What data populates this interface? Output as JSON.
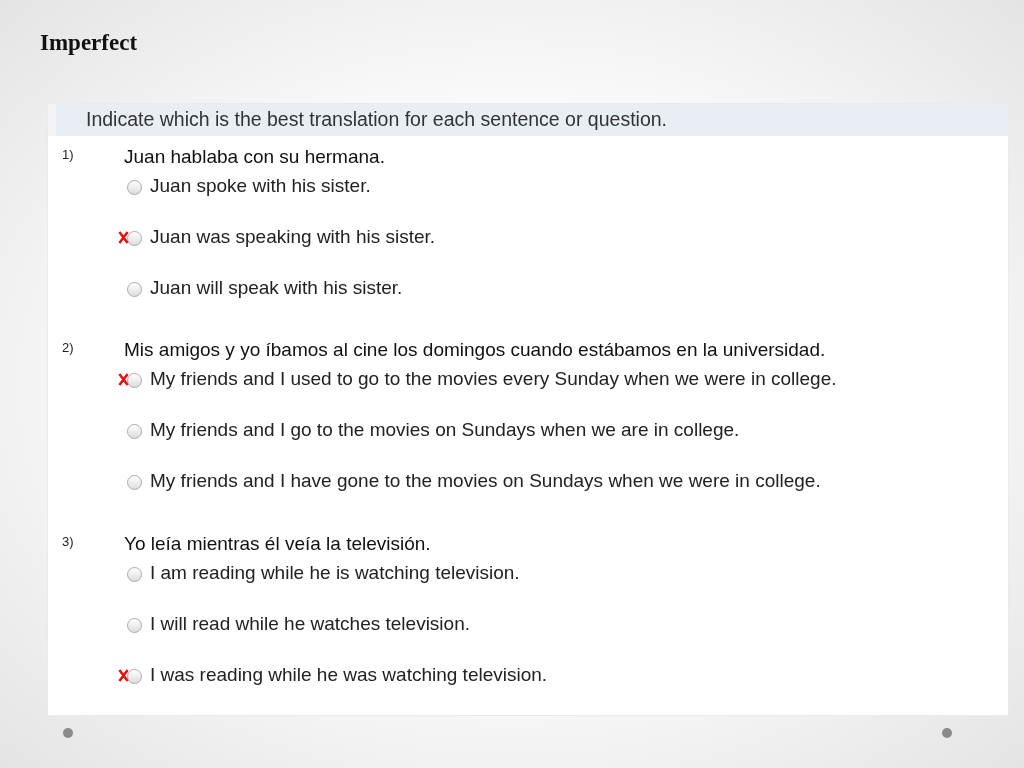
{
  "slide": {
    "title": "Imperfect"
  },
  "quiz": {
    "instruction": "Indicate which is the best translation for each sentence or question.",
    "questions": [
      {
        "number": "1)",
        "text": "Juan hablaba con su hermana.",
        "options": [
          {
            "text": "Juan spoke with his sister.",
            "marked": false,
            "selected": false
          },
          {
            "text": "Juan was speaking with his sister.",
            "marked": true,
            "selected": false
          },
          {
            "text": "Juan will speak with his sister.",
            "marked": false,
            "selected": false
          }
        ]
      },
      {
        "number": "2)",
        "text": "Mis amigos y yo íbamos al cine los domingos cuando estábamos en la universidad.",
        "options": [
          {
            "text": "My friends and I used to go to the movies every Sunday when we were in college.",
            "marked": true,
            "selected": false
          },
          {
            "text": "My friends and I go to the movies on Sundays when we are in college.",
            "marked": false,
            "selected": false
          },
          {
            "text": "My friends and I have gone to the movies on Sundays when we were in college.",
            "marked": false,
            "selected": false
          }
        ]
      },
      {
        "number": "3)",
        "text": "Yo leía mientras él veía la televisión.",
        "options": [
          {
            "text": "I am reading while he is watching television.",
            "marked": false,
            "selected": false
          },
          {
            "text": "I will read while he watches television.",
            "marked": false,
            "selected": false
          },
          {
            "text": "I was reading while he was watching television.",
            "marked": true,
            "selected": false
          }
        ]
      }
    ]
  }
}
